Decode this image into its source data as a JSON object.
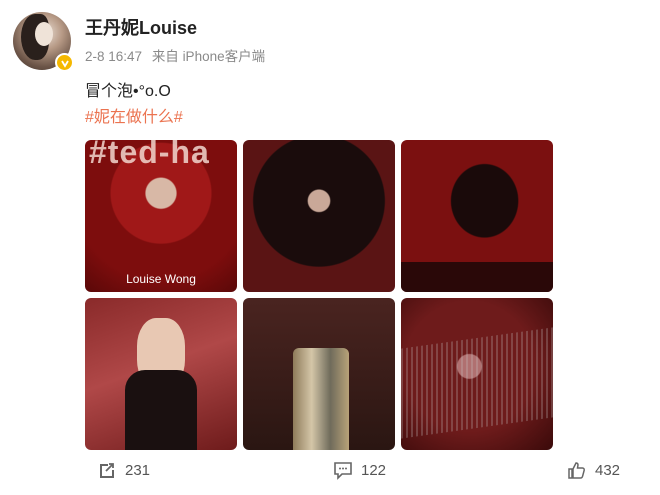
{
  "post": {
    "username": "王丹妮Louise",
    "date": "2-8 16:47",
    "source": "来自 iPhone客户端",
    "text": "冒个泡•°o.O",
    "hashtag": "#妮在做什么#"
  },
  "photos": [
    {
      "overlay_text": "#ted-ha",
      "caption": "Louise Wong"
    },
    {
      "caption": ""
    },
    {
      "caption": ""
    },
    {
      "caption": ""
    },
    {
      "caption": ""
    },
    {
      "caption": ""
    }
  ],
  "actions": {
    "repost_count": "231",
    "comment_count": "122",
    "like_count": "432"
  },
  "colors": {
    "hashtag": "#eb7350",
    "verified_badge": "#f5b800"
  },
  "icons": [
    "verified-icon",
    "repost-icon",
    "comment-icon",
    "like-icon"
  ]
}
